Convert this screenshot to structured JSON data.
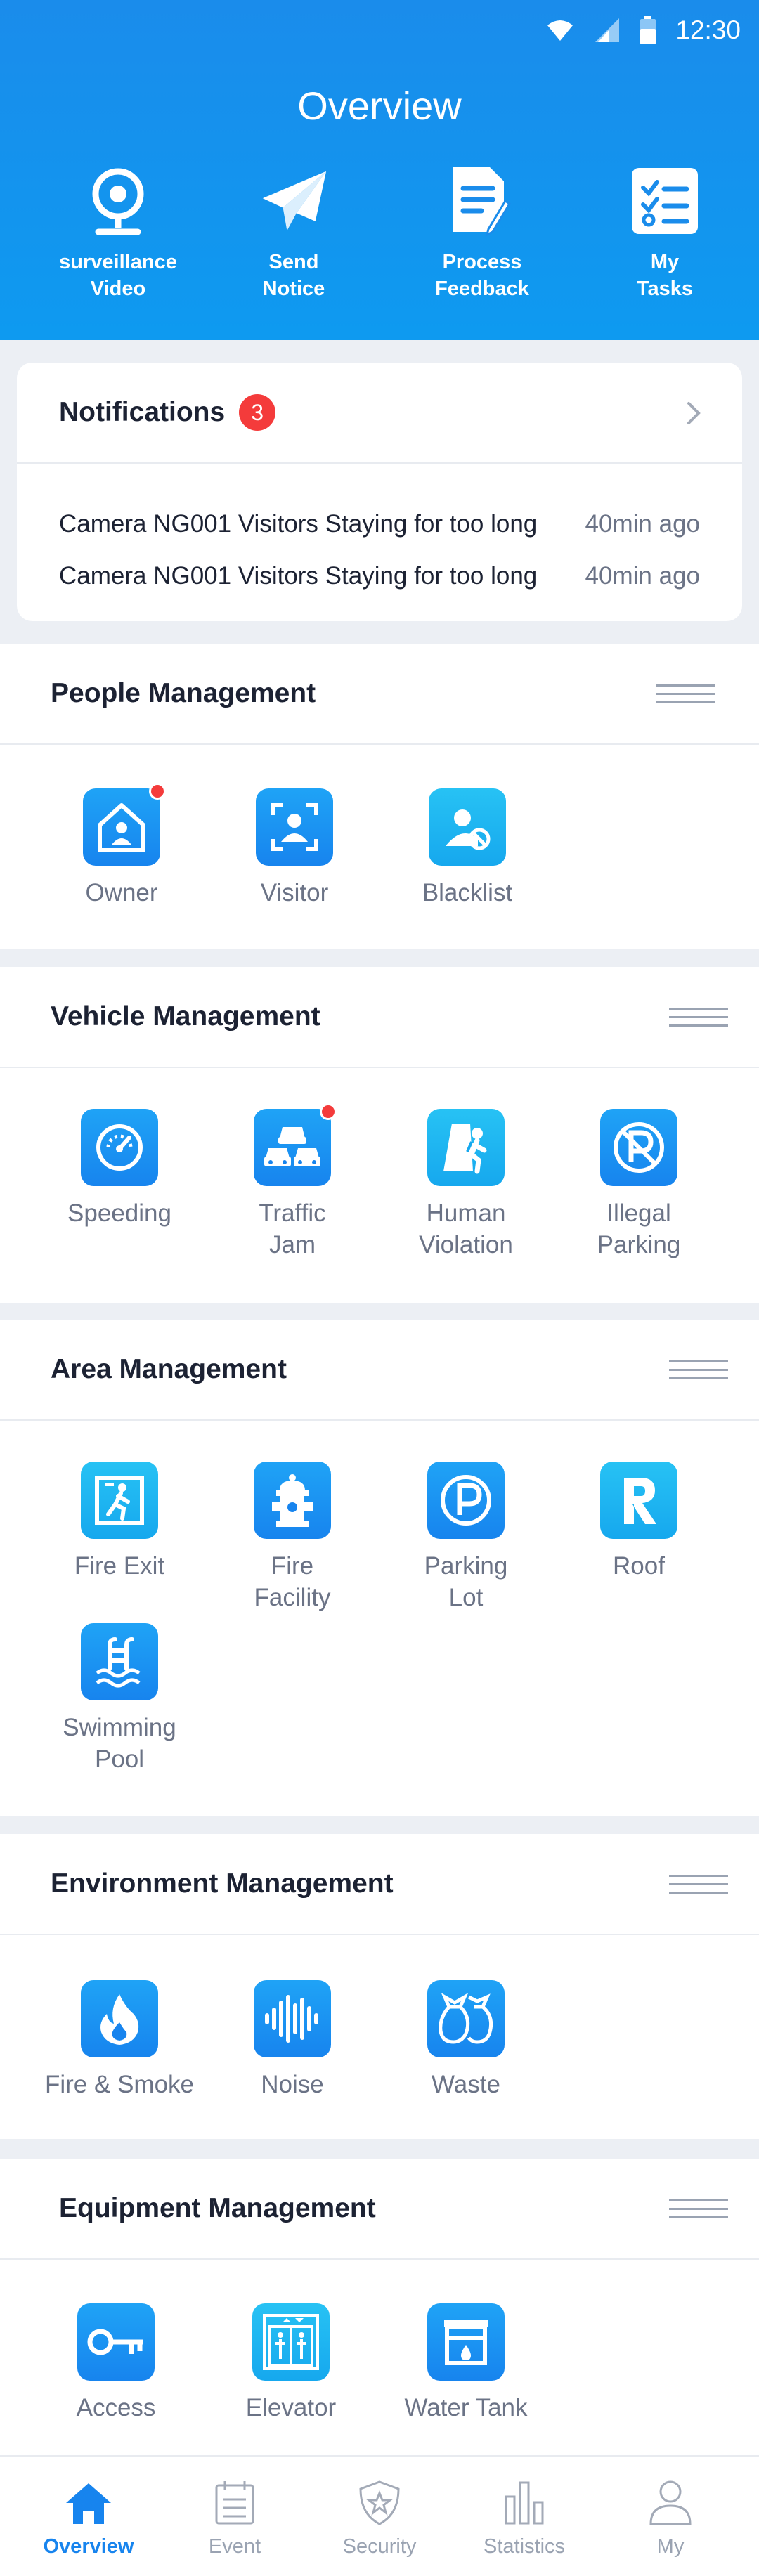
{
  "status_bar": {
    "time": "12:30"
  },
  "header": {
    "title": "Overview"
  },
  "quick_actions": [
    {
      "label": "surveillance\nVideo",
      "icon": "webcam-icon"
    },
    {
      "label": "Send\nNotice",
      "icon": "paper-plane-icon"
    },
    {
      "label": "Process\nFeedback",
      "icon": "document-edit-icon"
    },
    {
      "label": "My\nTasks",
      "icon": "task-list-icon"
    }
  ],
  "notifications": {
    "title": "Notifications",
    "count": "3",
    "items": [
      {
        "text": "Camera NG001 Visitors Staying for too long",
        "time": "40min ago"
      },
      {
        "text": "Camera NG001 Visitors Staying for too long",
        "time": "40min ago"
      }
    ]
  },
  "sections": {
    "people": {
      "title": "People Management",
      "items": [
        {
          "label": "Owner",
          "icon": "house-user-icon",
          "alert": true
        },
        {
          "label": "Visitor",
          "icon": "visitor-scan-icon"
        },
        {
          "label": "Blacklist",
          "icon": "user-blocked-icon"
        }
      ]
    },
    "vehicle": {
      "title": "Vehicle Management",
      "items": [
        {
          "label": "Speeding",
          "icon": "speedometer-icon"
        },
        {
          "label": "Traffic\nJam",
          "icon": "traffic-jam-icon",
          "alert": true
        },
        {
          "label": "Human\nViolation",
          "icon": "pedestrian-icon"
        },
        {
          "label": "Illegal\nParking",
          "icon": "no-parking-icon"
        }
      ]
    },
    "area": {
      "title": "Area Management",
      "items": [
        {
          "label": "Fire Exit",
          "icon": "fire-exit-icon"
        },
        {
          "label": "Fire\nFacility",
          "icon": "fire-hydrant-icon"
        },
        {
          "label": "Parking\nLot",
          "icon": "parking-icon"
        },
        {
          "label": "Roof",
          "icon": "roof-r-icon"
        },
        {
          "label": "Swimming\nPool",
          "icon": "swimming-pool-icon"
        }
      ]
    },
    "environment": {
      "title": "Environment Management",
      "items": [
        {
          "label": "Fire & Smoke",
          "icon": "flame-icon"
        },
        {
          "label": "Noise",
          "icon": "sound-wave-icon"
        },
        {
          "label": "Waste",
          "icon": "garbage-bags-icon"
        }
      ]
    },
    "equipment": {
      "title": "Equipment Management",
      "items": [
        {
          "label": "Access",
          "icon": "key-icon"
        },
        {
          "label": "Elevator",
          "icon": "elevator-icon"
        },
        {
          "label": "Water Tank",
          "icon": "water-tank-icon"
        }
      ]
    }
  },
  "tab_bar": [
    {
      "label": "Overview",
      "icon": "home-icon",
      "active": true
    },
    {
      "label": "Event",
      "icon": "calendar-icon"
    },
    {
      "label": "Security",
      "icon": "shield-star-icon"
    },
    {
      "label": "Statistics",
      "icon": "bar-chart-icon"
    },
    {
      "label": "My",
      "icon": "person-icon"
    }
  ],
  "colors": {
    "primary": "#1784EE",
    "header": "#1A8CEB",
    "badge": "#F43B3B",
    "muted": "#6B7386"
  }
}
